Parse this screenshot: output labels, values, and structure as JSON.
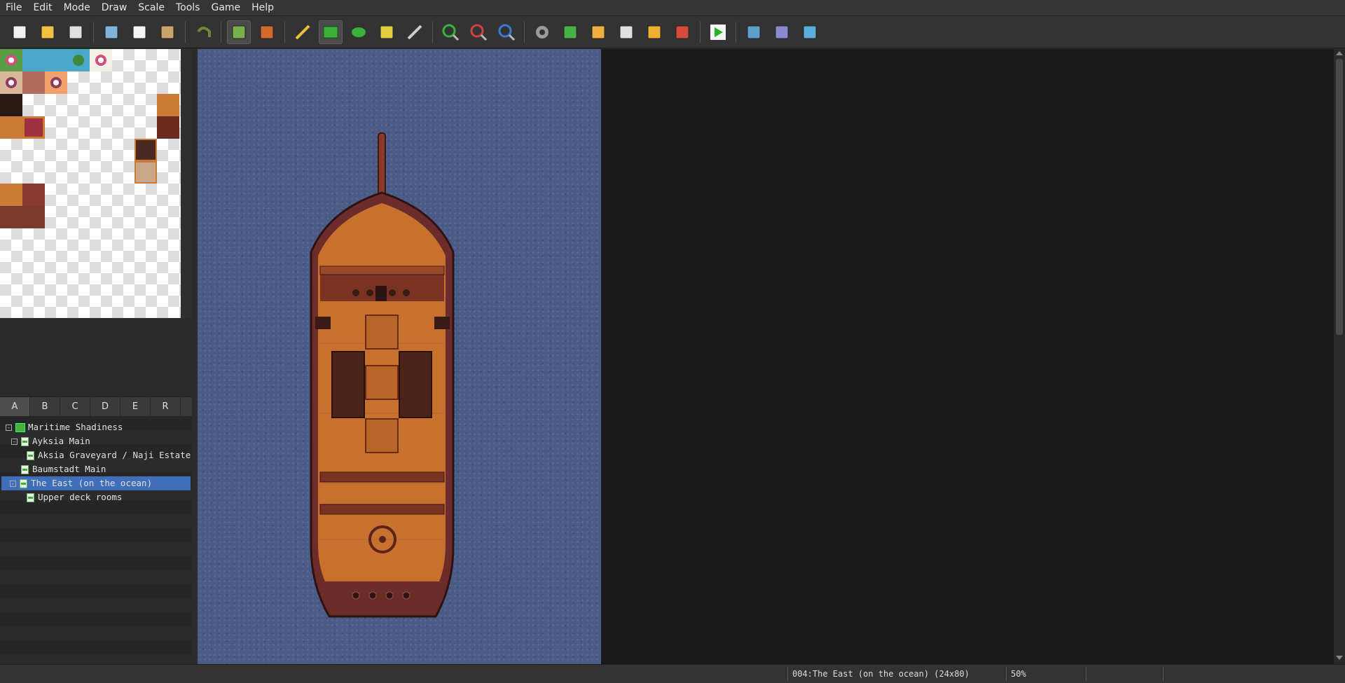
{
  "menu": [
    "File",
    "Edit",
    "Mode",
    "Draw",
    "Scale",
    "Tools",
    "Game",
    "Help"
  ],
  "toolbar": {
    "buttons": [
      {
        "name": "new-project-icon",
        "active": false
      },
      {
        "name": "open-project-icon",
        "active": false
      },
      {
        "name": "save-project-icon",
        "active": false
      },
      {
        "sep": true
      },
      {
        "name": "cut-icon",
        "active": false
      },
      {
        "name": "copy-icon",
        "active": false
      },
      {
        "name": "paste-icon",
        "active": false
      },
      {
        "sep": true
      },
      {
        "name": "undo-icon",
        "active": false
      },
      {
        "sep": true
      },
      {
        "name": "map-layer-icon",
        "active": true
      },
      {
        "name": "event-layer-icon",
        "active": false
      },
      {
        "sep": true
      },
      {
        "name": "pencil-icon",
        "active": false
      },
      {
        "name": "rectangle-icon",
        "active": true
      },
      {
        "name": "ellipse-icon",
        "active": false
      },
      {
        "name": "fill-icon",
        "active": false
      },
      {
        "name": "shadow-pen-icon",
        "active": false
      },
      {
        "sep": true
      },
      {
        "name": "zoom-in-icon",
        "active": false
      },
      {
        "name": "zoom-out-icon",
        "active": false
      },
      {
        "name": "zoom-actual-icon",
        "active": false
      },
      {
        "sep": true
      },
      {
        "name": "database-icon",
        "active": false
      },
      {
        "name": "plugin-manager-icon",
        "active": false
      },
      {
        "name": "sound-test-icon",
        "active": false
      },
      {
        "name": "event-search-icon",
        "active": false
      },
      {
        "name": "resource-manager-icon",
        "active": false
      },
      {
        "name": "character-generator-icon",
        "active": false
      },
      {
        "sep": true
      },
      {
        "name": "playtest-icon",
        "active": false
      },
      {
        "sep": true
      },
      {
        "name": "deployment-icon",
        "active": false
      },
      {
        "name": "steam-management-icon",
        "active": false
      },
      {
        "name": "tutorial-icon",
        "active": false
      }
    ]
  },
  "tileset_tabs": [
    "A",
    "B",
    "C",
    "D",
    "E",
    "R"
  ],
  "selected_tab": "A",
  "map_tree": {
    "project": "Maritime Shadiness",
    "nodes": [
      {
        "label": "Ayksia Main",
        "level": 1,
        "expander": "-"
      },
      {
        "label": "Aksia Graveyard / Naji Estate",
        "level": 2,
        "expander": ""
      },
      {
        "label": "Baumstadt Main",
        "level": 1,
        "expander": ""
      },
      {
        "label": "The East (on the ocean)",
        "level": 1,
        "expander": "-",
        "selected": true
      },
      {
        "label": "Upper deck rooms",
        "level": 2,
        "expander": ""
      }
    ]
  },
  "status": {
    "map_info": "004:The East (on the ocean) (24x80)",
    "zoom": "50%"
  },
  "colors": {
    "selection": "#3f6fb8",
    "ocean": "#4a5c85",
    "deck": "#c8712f",
    "hull": "#5a2a2a"
  }
}
